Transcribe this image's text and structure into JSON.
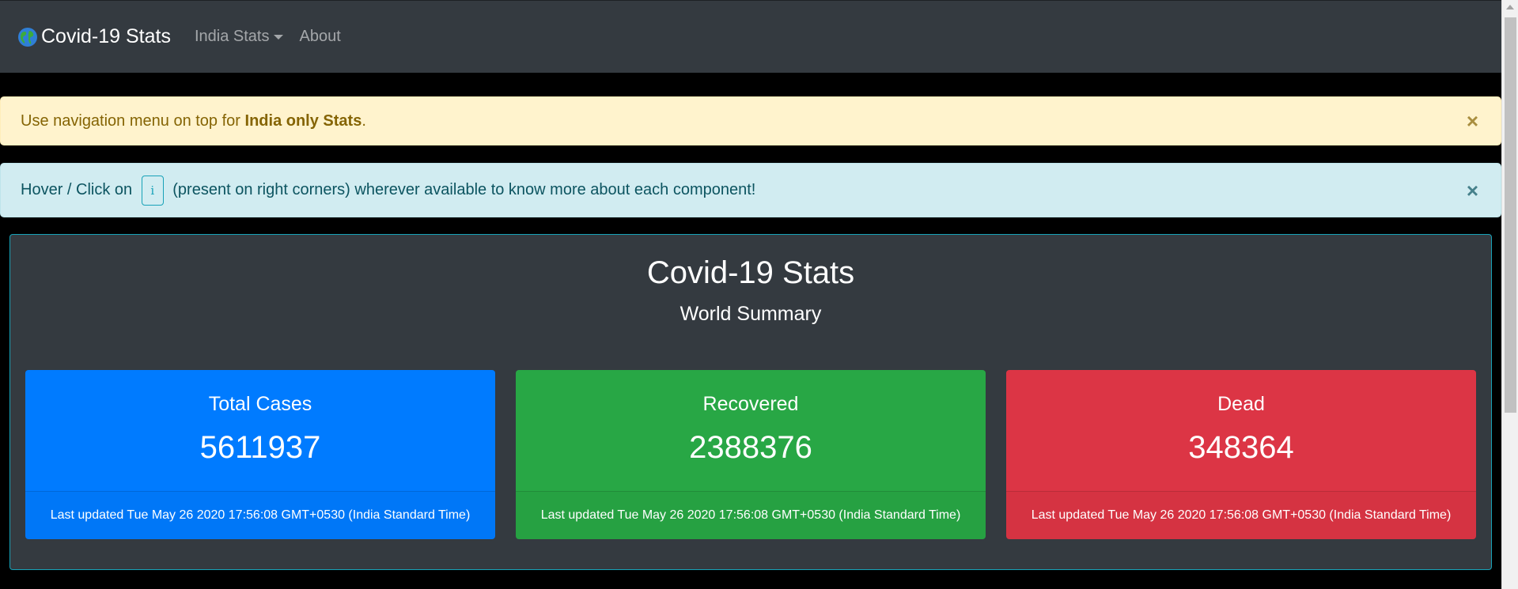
{
  "navbar": {
    "brand": "Covid-19 Stats",
    "brand_icon": "globe-icon",
    "menu_dropdown": "India Stats",
    "menu_about": "About"
  },
  "alerts": {
    "warning": {
      "prefix": "Use navigation menu on top for ",
      "strong": "India only Stats",
      "suffix": ".",
      "close": "×"
    },
    "info": {
      "prefix": "Hover / Click on ",
      "icon_glyph": "i",
      "suffix": " (present on right corners) wherever available to know more about each component!",
      "close": "×"
    }
  },
  "summary": {
    "title": "Covid-19 Stats",
    "subtitle": "World Summary",
    "cards": [
      {
        "title": "Total Cases",
        "value": "5611937",
        "footer": "Last updated Tue May 26 2020 17:56:08 GMT+0530 (India Standard Time)",
        "color": "#007bff"
      },
      {
        "title": "Recovered",
        "value": "2388376",
        "footer": "Last updated Tue May 26 2020 17:56:08 GMT+0530 (India Standard Time)",
        "color": "#28a745"
      },
      {
        "title": "Dead",
        "value": "348364",
        "footer": "Last updated Tue May 26 2020 17:56:08 GMT+0530 (India Standard Time)",
        "color": "#dc3545"
      }
    ]
  },
  "colors": {
    "navbar_bg": "#343a40",
    "warning_bg": "#fff3cd",
    "info_bg": "#d1ecf1",
    "panel_border": "#17a2b8"
  }
}
